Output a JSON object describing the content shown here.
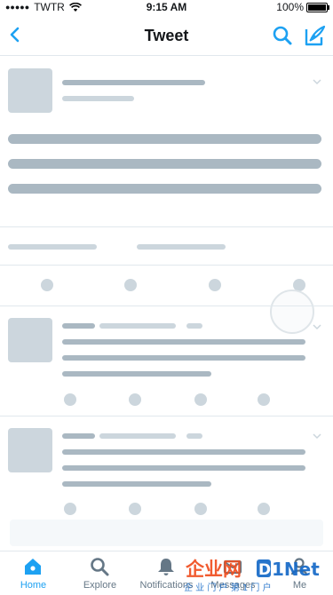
{
  "status_bar": {
    "carrier": "TWTR",
    "time": "9:15 AM",
    "battery": "100%"
  },
  "nav": {
    "title": "Tweet",
    "back_icon": "chevron-left-icon",
    "search_icon": "search-icon",
    "compose_icon": "compose-icon"
  },
  "tab_bar": {
    "tabs": [
      {
        "label": "Home",
        "icon": "home-icon",
        "active": true
      },
      {
        "label": "Explore",
        "icon": "search-icon",
        "active": false
      },
      {
        "label": "Notifications",
        "icon": "bell-icon",
        "active": false
      },
      {
        "label": "Messages",
        "icon": "envelope-icon",
        "active": false
      },
      {
        "label": "Me",
        "icon": "person-icon",
        "active": false
      }
    ]
  },
  "watermark": {
    "brand_left": "企业网",
    "brand_right": "D1Net",
    "tagline": "企 业 门 户 第 1 门 户"
  },
  "colors": {
    "accent": "#1da1f2",
    "skeleton_dark": "#aab8c2",
    "skeleton_light": "#ccd6dd",
    "divider": "#e1e8ed"
  }
}
